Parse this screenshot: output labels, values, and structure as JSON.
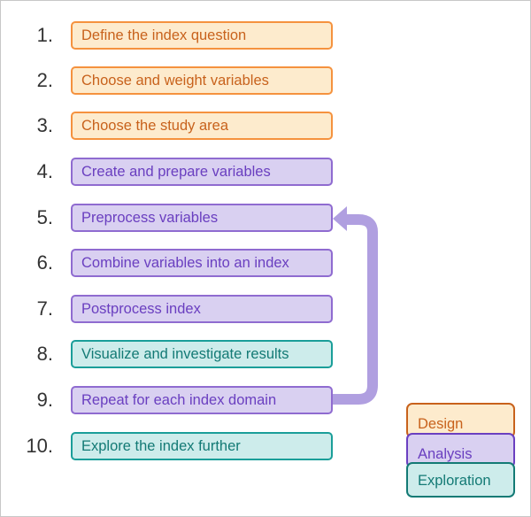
{
  "colors": {
    "design": "#f5923e",
    "analysis": "#8f6bd0",
    "exploration": "#1a9e99",
    "arrow": "#b09fe0"
  },
  "steps": [
    {
      "number": "1.",
      "label": "Define the index question",
      "category": "design"
    },
    {
      "number": "2.",
      "label": "Choose and weight variables",
      "category": "design"
    },
    {
      "number": "3.",
      "label": "Choose the study area",
      "category": "design"
    },
    {
      "number": "4.",
      "label": "Create and prepare variables",
      "category": "analysis"
    },
    {
      "number": "5.",
      "label": "Preprocess variables",
      "category": "analysis"
    },
    {
      "number": "6.",
      "label": "Combine variables into an index",
      "category": "analysis"
    },
    {
      "number": "7.",
      "label": "Postprocess index",
      "category": "analysis"
    },
    {
      "number": "8.",
      "label": "Visualize and investigate results",
      "category": "exploration"
    },
    {
      "number": "9.",
      "label": "Repeat for each index domain",
      "category": "analysis"
    },
    {
      "number": "10.",
      "label": "Explore the index further",
      "category": "exploration"
    }
  ],
  "loop_arrow": {
    "from_step": "9.",
    "to_step": "5."
  },
  "legend": [
    {
      "label": "Design",
      "category": "design"
    },
    {
      "label": "Analysis",
      "category": "analysis"
    },
    {
      "label": "Exploration",
      "category": "exploration"
    }
  ]
}
